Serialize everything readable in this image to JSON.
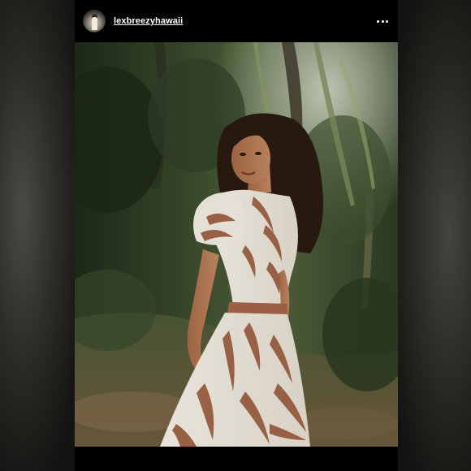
{
  "post": {
    "username": "lexbreezyhawaii",
    "avatar_icon": "profile-avatar",
    "more_icon": "more-options-icon"
  },
  "photo": {
    "icon": "photo-image"
  },
  "colors": {
    "header_bg": "#000000",
    "username_text": "#ffffff",
    "foliage_dark": "#26331f",
    "foliage_light": "#6f7f55",
    "dress_white": "#f4efe6",
    "dress_print": "#9a5a3a",
    "hair": "#2a1a12",
    "skin": "#b57a55"
  }
}
